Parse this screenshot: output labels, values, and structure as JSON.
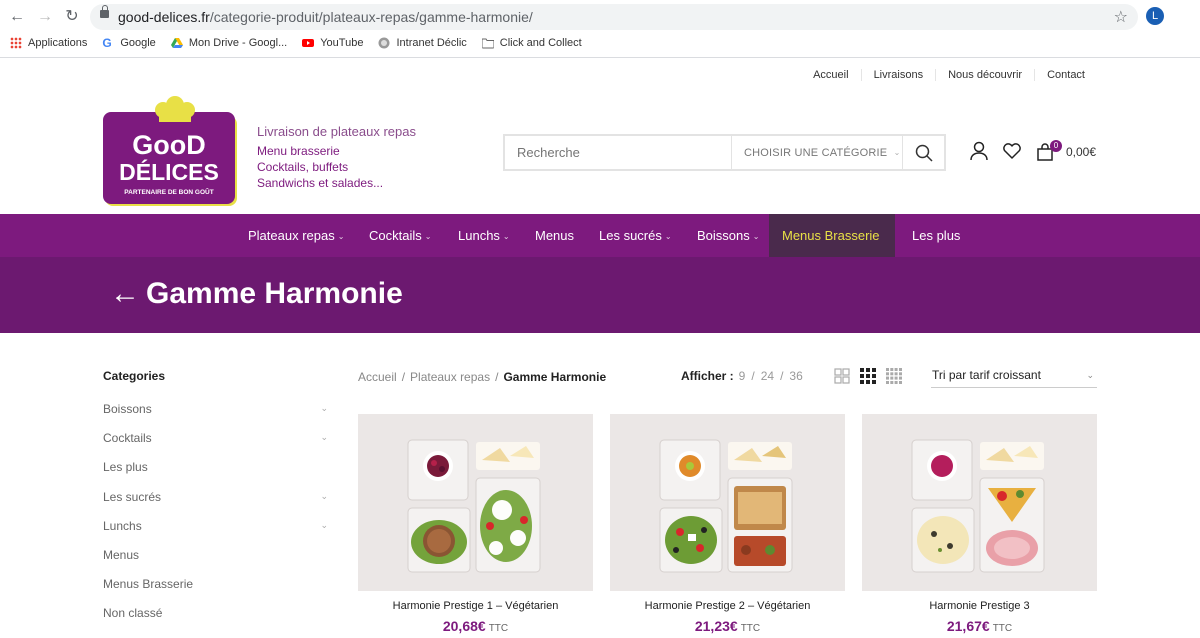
{
  "browser": {
    "url_host": "good-delices.fr",
    "url_path": "/categorie-produit/plateaux-repas/gamme-harmonie/",
    "profile_initial": "L",
    "bookmarks": [
      {
        "label": "Applications",
        "icon": "apps-grid-icon"
      },
      {
        "label": "Google",
        "icon": "google-icon"
      },
      {
        "label": "Mon Drive - Googl...",
        "icon": "drive-icon"
      },
      {
        "label": "YouTube",
        "icon": "youtube-icon"
      },
      {
        "label": "Intranet Déclic",
        "icon": "globe-icon"
      },
      {
        "label": "Click and Collect",
        "icon": "folder-icon"
      }
    ]
  },
  "toplinks": [
    "Accueil",
    "Livraisons",
    "Nous découvrir",
    "Contact"
  ],
  "logo": {
    "line1": "GooD",
    "line2": "DÉLICES",
    "line3": "PARTENAIRE DE BON GOÛT"
  },
  "tagline": {
    "title": "Livraison de plateaux repas",
    "lines": [
      "Menu brasserie",
      "Cocktails, buffets",
      "Sandwichs et salades..."
    ]
  },
  "search": {
    "placeholder": "Recherche",
    "category_label": "Choisir une catégorie"
  },
  "cart": {
    "count": "0",
    "total": "0,00€"
  },
  "nav": [
    {
      "label": "Plateaux repas",
      "caret": true
    },
    {
      "label": "Cocktails",
      "caret": true
    },
    {
      "label": "Lunchs",
      "caret": true
    },
    {
      "label": "Menus",
      "caret": false
    },
    {
      "label": "Les sucrés",
      "caret": true
    },
    {
      "label": "Boissons",
      "caret": true
    },
    {
      "label": "Menus Brasserie",
      "caret": false,
      "active": true
    },
    {
      "label": "Les plus",
      "caret": false
    }
  ],
  "page": {
    "title": "Gamme Harmonie"
  },
  "sidebar": {
    "title": "Categories",
    "items": [
      {
        "label": "Boissons",
        "expandable": true
      },
      {
        "label": "Cocktails",
        "expandable": true
      },
      {
        "label": "Les plus",
        "expandable": false
      },
      {
        "label": "Les sucrés",
        "expandable": true
      },
      {
        "label": "Lunchs",
        "expandable": true
      },
      {
        "label": "Menus",
        "expandable": false
      },
      {
        "label": "Menus Brasserie",
        "expandable": false
      },
      {
        "label": "Non classé",
        "expandable": false
      }
    ]
  },
  "breadcrumb": {
    "home": "Accueil",
    "parent": "Plateaux repas",
    "current": "Gamme Harmonie"
  },
  "perpage": {
    "label": "Afficher :",
    "options": [
      "9",
      "24",
      "36"
    ]
  },
  "sort": {
    "selected": "Tri par tarif croissant"
  },
  "colors": {
    "brand": "#7d1a7e",
    "banner": "#6c1970",
    "active_nav": "#e8e046"
  },
  "products": [
    {
      "name": "Harmonie Prestige 1 – Végétarien",
      "price": "20,68€",
      "suffix": "TTC"
    },
    {
      "name": "Harmonie Prestige 2 – Végétarien",
      "price": "21,23€",
      "suffix": "TTC"
    },
    {
      "name": "Harmonie Prestige 3",
      "price": "21,67€",
      "suffix": "TTC"
    }
  ]
}
